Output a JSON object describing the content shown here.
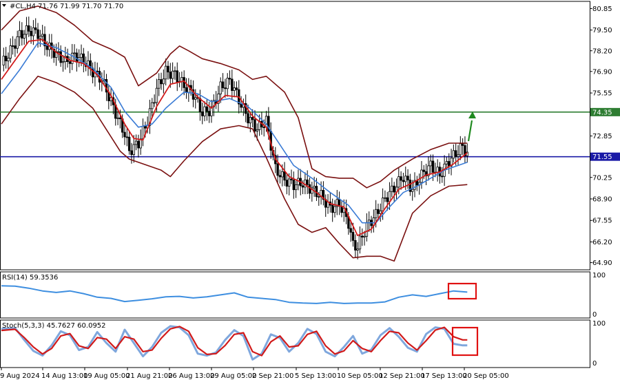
{
  "chart_data": {
    "type": "candlestick",
    "title": "#CL,H4  71.76 71.99 71.70 71.70",
    "price_axis": {
      "ylim": [
        64.45,
        81.3
      ],
      "ticks": [
        "80.85",
        "79.50",
        "78.20",
        "76.90",
        "75.55",
        "74.35",
        "72.85",
        "71.55",
        "70.25",
        "68.90",
        "67.55",
        "66.20",
        "64.90"
      ]
    },
    "time_axis": {
      "labels": [
        "9 Aug 2024",
        "14 Aug 13:00",
        "19 Aug 05:00",
        "21 Aug 21:00",
        "26 Aug 13:00",
        "29 Aug 05:00",
        "2 Sep 21:00",
        "5 Sep 13:00",
        "10 Sep 05:00",
        "12 Sep 21:00",
        "17 Sep 13:00",
        "20 Sep 05:00"
      ]
    },
    "levels": [
      {
        "value": 74.35,
        "label": "74.35",
        "color": "#2e7d32"
      },
      {
        "value": 71.55,
        "label": "71.55",
        "color": "#1a1aa6"
      }
    ],
    "close_path": [
      [
        0,
        77.3
      ],
      [
        2,
        78.2
      ],
      [
        4,
        79.2
      ],
      [
        6,
        79.5
      ],
      [
        8,
        79.3
      ],
      [
        10,
        78.5
      ],
      [
        12,
        78.0
      ],
      [
        14,
        77.5
      ],
      [
        16,
        77.9
      ],
      [
        18,
        77.6
      ],
      [
        20,
        76.9
      ],
      [
        22,
        76.4
      ],
      [
        24,
        75.0
      ],
      [
        26,
        73.6
      ],
      [
        27,
        73.0
      ],
      [
        28,
        71.9
      ],
      [
        30,
        72.4
      ],
      [
        32,
        73.8
      ],
      [
        34,
        75.8
      ],
      [
        36,
        76.9
      ],
      [
        38,
        76.7
      ],
      [
        40,
        76.0
      ],
      [
        42,
        75.5
      ],
      [
        44,
        74.3
      ],
      [
        46,
        74.5
      ],
      [
        48,
        75.9
      ],
      [
        50,
        76.3
      ],
      [
        51,
        75.8
      ],
      [
        52,
        75.1
      ],
      [
        54,
        74.0
      ],
      [
        56,
        73.3
      ],
      [
        58,
        73.8
      ],
      [
        60,
        70.8
      ],
      [
        62,
        70.1
      ],
      [
        64,
        69.8
      ],
      [
        66,
        69.9
      ],
      [
        68,
        69.5
      ],
      [
        70,
        69.1
      ],
      [
        72,
        68.3
      ],
      [
        74,
        68.6
      ],
      [
        76,
        67.4
      ],
      [
        77,
        66.0
      ],
      [
        78,
        65.9
      ],
      [
        80,
        67.2
      ],
      [
        82,
        67.9
      ],
      [
        84,
        68.9
      ],
      [
        86,
        69.6
      ],
      [
        88,
        70.3
      ],
      [
        90,
        69.5
      ],
      [
        92,
        70.4
      ],
      [
        94,
        71.0
      ],
      [
        96,
        70.4
      ],
      [
        98,
        71.3
      ],
      [
        100,
        71.9
      ],
      [
        101,
        72.2
      ],
      [
        102,
        71.7
      ]
    ],
    "bb_upper_path": [
      [
        0,
        79.5
      ],
      [
        4,
        80.7
      ],
      [
        8,
        81.0
      ],
      [
        12,
        80.6
      ],
      [
        16,
        79.8
      ],
      [
        20,
        78.8
      ],
      [
        24,
        78.3
      ],
      [
        27,
        77.8
      ],
      [
        30,
        76.0
      ],
      [
        34,
        76.8
      ],
      [
        37,
        78.0
      ],
      [
        39,
        78.5
      ],
      [
        41,
        78.2
      ],
      [
        44,
        77.7
      ],
      [
        48,
        77.4
      ],
      [
        52,
        77.0
      ],
      [
        55,
        76.4
      ],
      [
        58,
        76.6
      ],
      [
        62,
        75.6
      ],
      [
        65,
        74.0
      ],
      [
        68,
        70.8
      ],
      [
        71,
        70.3
      ],
      [
        74,
        70.2
      ],
      [
        77,
        70.2
      ],
      [
        80,
        69.6
      ],
      [
        83,
        70.0
      ],
      [
        86,
        70.7
      ],
      [
        90,
        71.4
      ],
      [
        94,
        72.0
      ],
      [
        98,
        72.4
      ],
      [
        102,
        72.4
      ]
    ],
    "bb_lower_path": [
      [
        0,
        73.6
      ],
      [
        4,
        75.2
      ],
      [
        8,
        76.6
      ],
      [
        12,
        76.2
      ],
      [
        16,
        75.6
      ],
      [
        20,
        74.6
      ],
      [
        24,
        72.8
      ],
      [
        26,
        71.9
      ],
      [
        28,
        71.4
      ],
      [
        32,
        71.0
      ],
      [
        35,
        70.7
      ],
      [
        37,
        70.3
      ],
      [
        40,
        71.3
      ],
      [
        44,
        72.5
      ],
      [
        48,
        73.3
      ],
      [
        52,
        73.5
      ],
      [
        55,
        73.3
      ],
      [
        58,
        71.5
      ],
      [
        62,
        68.9
      ],
      [
        65,
        67.3
      ],
      [
        68,
        66.8
      ],
      [
        71,
        67.1
      ],
      [
        74,
        66.1
      ],
      [
        77,
        65.2
      ],
      [
        80,
        65.3
      ],
      [
        83,
        65.3
      ],
      [
        86,
        65.0
      ],
      [
        90,
        68.0
      ],
      [
        94,
        69.1
      ],
      [
        98,
        69.7
      ],
      [
        102,
        69.8
      ]
    ],
    "ma_fast_path": [
      [
        0,
        76.4
      ],
      [
        3,
        77.6
      ],
      [
        6,
        78.8
      ],
      [
        9,
        78.9
      ],
      [
        12,
        78.1
      ],
      [
        15,
        77.6
      ],
      [
        18,
        77.4
      ],
      [
        21,
        76.7
      ],
      [
        24,
        75.4
      ],
      [
        27,
        73.6
      ],
      [
        29,
        72.7
      ],
      [
        31,
        72.6
      ],
      [
        34,
        74.7
      ],
      [
        37,
        76.1
      ],
      [
        40,
        76.3
      ],
      [
        43,
        75.3
      ],
      [
        46,
        74.6
      ],
      [
        49,
        75.4
      ],
      [
        52,
        75.3
      ],
      [
        55,
        74.1
      ],
      [
        58,
        73.4
      ],
      [
        60,
        71.4
      ],
      [
        63,
        70.3
      ],
      [
        66,
        69.9
      ],
      [
        69,
        69.3
      ],
      [
        72,
        68.6
      ],
      [
        75,
        68.4
      ],
      [
        78,
        66.6
      ],
      [
        81,
        67.0
      ],
      [
        84,
        68.3
      ],
      [
        87,
        69.5
      ],
      [
        90,
        69.9
      ],
      [
        93,
        70.4
      ],
      [
        96,
        70.6
      ],
      [
        99,
        71.1
      ],
      [
        102,
        71.8
      ]
    ],
    "ma_slow_path": [
      [
        0,
        75.5
      ],
      [
        4,
        77.0
      ],
      [
        8,
        78.7
      ],
      [
        12,
        78.4
      ],
      [
        16,
        77.8
      ],
      [
        20,
        77.1
      ],
      [
        24,
        75.9
      ],
      [
        27,
        74.4
      ],
      [
        30,
        73.4
      ],
      [
        33,
        73.6
      ],
      [
        36,
        74.6
      ],
      [
        40,
        75.6
      ],
      [
        43,
        75.5
      ],
      [
        46,
        75.0
      ],
      [
        50,
        75.2
      ],
      [
        54,
        74.7
      ],
      [
        58,
        73.6
      ],
      [
        61,
        72.3
      ],
      [
        64,
        71.0
      ],
      [
        68,
        70.2
      ],
      [
        72,
        69.3
      ],
      [
        76,
        68.5
      ],
      [
        79,
        67.4
      ],
      [
        82,
        67.4
      ],
      [
        85,
        68.4
      ],
      [
        88,
        69.3
      ],
      [
        91,
        69.7
      ],
      [
        94,
        70.2
      ],
      [
        97,
        70.7
      ],
      [
        100,
        71.0
      ],
      [
        102,
        71.2
      ]
    ],
    "rsi": {
      "label": "RSI(14) 59.3536",
      "ylim": [
        0,
        100
      ],
      "ticks": [
        "100",
        "0"
      ],
      "path": [
        [
          0,
          75
        ],
        [
          3,
          74
        ],
        [
          6,
          69
        ],
        [
          9,
          62
        ],
        [
          12,
          58
        ],
        [
          15,
          62
        ],
        [
          18,
          55
        ],
        [
          21,
          46
        ],
        [
          24,
          43
        ],
        [
          27,
          35
        ],
        [
          30,
          38
        ],
        [
          33,
          42
        ],
        [
          36,
          47
        ],
        [
          39,
          48
        ],
        [
          42,
          44
        ],
        [
          45,
          47
        ],
        [
          48,
          52
        ],
        [
          51,
          57
        ],
        [
          54,
          46
        ],
        [
          57,
          43
        ],
        [
          60,
          40
        ],
        [
          63,
          33
        ],
        [
          66,
          31
        ],
        [
          69,
          30
        ],
        [
          72,
          33
        ],
        [
          75,
          30
        ],
        [
          78,
          31
        ],
        [
          81,
          31
        ],
        [
          84,
          34
        ],
        [
          87,
          46
        ],
        [
          90,
          52
        ],
        [
          93,
          48
        ],
        [
          96,
          55
        ],
        [
          99,
          62
        ],
        [
          102,
          59
        ]
      ]
    },
    "stoch": {
      "label": "Stoch(5,3,3) 45.7627 60.0952",
      "ylim": [
        0,
        100
      ],
      "ticks": [
        "100",
        "0"
      ],
      "main_path": [
        [
          0,
          88
        ],
        [
          3,
          90
        ],
        [
          5,
          60
        ],
        [
          7,
          32
        ],
        [
          9,
          20
        ],
        [
          11,
          46
        ],
        [
          13,
          82
        ],
        [
          15,
          72
        ],
        [
          17,
          34
        ],
        [
          19,
          42
        ],
        [
          21,
          80
        ],
        [
          23,
          52
        ],
        [
          25,
          30
        ],
        [
          27,
          86
        ],
        [
          29,
          52
        ],
        [
          31,
          18
        ],
        [
          33,
          42
        ],
        [
          35,
          78
        ],
        [
          37,
          95
        ],
        [
          39,
          92
        ],
        [
          41,
          72
        ],
        [
          43,
          25
        ],
        [
          45,
          20
        ],
        [
          47,
          28
        ],
        [
          49,
          60
        ],
        [
          51,
          85
        ],
        [
          53,
          70
        ],
        [
          55,
          10
        ],
        [
          57,
          25
        ],
        [
          59,
          74
        ],
        [
          61,
          65
        ],
        [
          63,
          30
        ],
        [
          65,
          52
        ],
        [
          67,
          88
        ],
        [
          69,
          75
        ],
        [
          71,
          30
        ],
        [
          73,
          18
        ],
        [
          75,
          42
        ],
        [
          77,
          70
        ],
        [
          79,
          25
        ],
        [
          81,
          35
        ],
        [
          83,
          72
        ],
        [
          85,
          90
        ],
        [
          87,
          68
        ],
        [
          89,
          40
        ],
        [
          91,
          30
        ],
        [
          93,
          75
        ],
        [
          95,
          92
        ],
        [
          97,
          88
        ],
        [
          99,
          50
        ],
        [
          101,
          46
        ],
        [
          102,
          46
        ]
      ],
      "signal_path": [
        [
          0,
          84
        ],
        [
          3,
          87
        ],
        [
          5,
          66
        ],
        [
          7,
          42
        ],
        [
          9,
          24
        ],
        [
          11,
          38
        ],
        [
          13,
          70
        ],
        [
          15,
          76
        ],
        [
          17,
          45
        ],
        [
          19,
          38
        ],
        [
          21,
          66
        ],
        [
          23,
          62
        ],
        [
          25,
          38
        ],
        [
          27,
          68
        ],
        [
          29,
          62
        ],
        [
          31,
          30
        ],
        [
          33,
          34
        ],
        [
          35,
          64
        ],
        [
          37,
          88
        ],
        [
          39,
          94
        ],
        [
          41,
          82
        ],
        [
          43,
          40
        ],
        [
          45,
          23
        ],
        [
          47,
          25
        ],
        [
          49,
          46
        ],
        [
          51,
          74
        ],
        [
          53,
          78
        ],
        [
          55,
          30
        ],
        [
          57,
          20
        ],
        [
          59,
          55
        ],
        [
          61,
          70
        ],
        [
          63,
          42
        ],
        [
          65,
          45
        ],
        [
          67,
          74
        ],
        [
          69,
          82
        ],
        [
          71,
          45
        ],
        [
          73,
          24
        ],
        [
          75,
          32
        ],
        [
          77,
          58
        ],
        [
          79,
          38
        ],
        [
          81,
          30
        ],
        [
          83,
          58
        ],
        [
          85,
          82
        ],
        [
          87,
          78
        ],
        [
          89,
          52
        ],
        [
          91,
          34
        ],
        [
          93,
          58
        ],
        [
          95,
          85
        ],
        [
          97,
          92
        ],
        [
          99,
          68
        ],
        [
          101,
          60
        ],
        [
          102,
          60
        ]
      ]
    },
    "colors": {
      "bb": "#7a1010",
      "ma_fast": "#d11a1a",
      "ma_slow": "#3a7bd5",
      "rsi": "#3d8ee0",
      "stoch_main": "#7fa7dd",
      "stoch_signal": "#d11a1a",
      "candle": "#000000",
      "highlight": "#e01010",
      "arrow": "#1f8a1f"
    }
  }
}
